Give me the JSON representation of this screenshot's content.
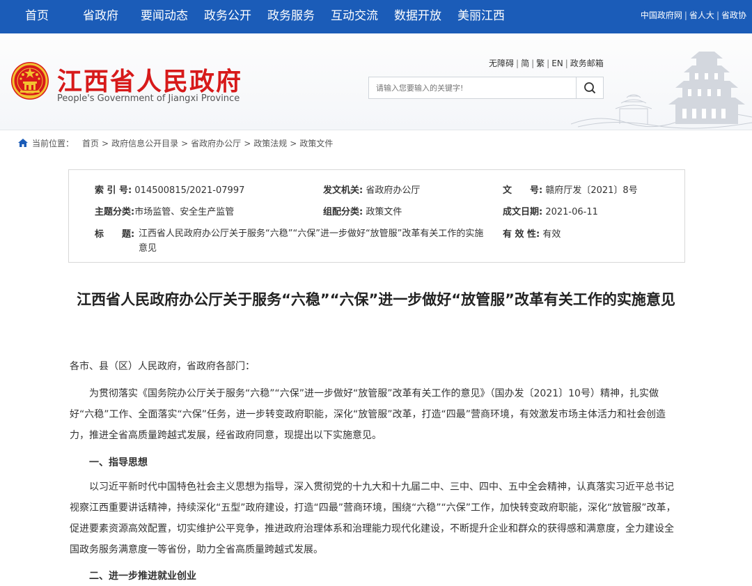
{
  "nav": {
    "items": [
      "首页",
      "省政府",
      "要闻动态",
      "政务公开",
      "政务服务",
      "互动交流",
      "数据开放",
      "美丽江西"
    ],
    "right_links": [
      "中国政府网",
      "省人大",
      "省政协"
    ]
  },
  "header": {
    "site_name": "江西省人民政府",
    "site_name_en": "People's Government of Jiangxi Province",
    "util_links": [
      "无障碍",
      "简",
      "繁",
      "EN",
      "政务邮箱"
    ],
    "search_placeholder": "请输入您要输入的关键字!"
  },
  "breadcrumb": {
    "label": "当前位置：",
    "items": [
      "首页",
      "政府信息公开目录",
      "省政府办公厅",
      "政策法规",
      "政策文件"
    ]
  },
  "info": {
    "index_label": "索 引 号:",
    "index_value": "014500815/2021-07997",
    "issuer_label": "发文机关:",
    "issuer_value": "省政府办公厅",
    "docno_label": "文　　号:",
    "docno_value": "赣府厅发〔2021〕8号",
    "topic_label": "主题分类:",
    "topic_value": "市场监管、安全生产监管",
    "category_label": "组配分类:",
    "category_value": "政策文件",
    "date_label": "成文日期:",
    "date_value": "2021-06-11",
    "title_label": "标　　题:",
    "title_value": "江西省人民政府办公厅关于服务“六稳”“六保”进一步做好“放管服”改革有关工作的实施意见",
    "valid_label": "有 效 性:",
    "valid_value": "有效"
  },
  "article": {
    "title": "江西省人民政府办公厅关于服务“六稳”“六保”进一步做好“放管服”改革有关工作的实施意见",
    "salutation": "各市、县（区）人民政府，省政府各部门：",
    "p1": "为贯彻落实《国务院办公厅关于服务“六稳”“六保”进一步做好“放管服”改革有关工作的意见》（国办发〔2021〕10号）精神，扎实做好“六稳”工作、全面落实“六保”任务，进一步转变政府职能，深化“放管服”改革，打造“四最”营商环境，有效激发市场主体活力和社会创造力，推进全省高质量跨越式发展，经省政府同意，现提出以下实施意见。",
    "h1": "一、指导思想",
    "p2": "以习近平新时代中国特色社会主义思想为指导，深入贯彻党的十九大和十九届二中、三中、四中、五中全会精神，认真落实习近平总书记视察江西重要讲话精神，持续深化“五型”政府建设，打造“四最”营商环境，围绕“六稳”“六保”工作，加快转变政府职能，深化“放管服”改革，促进要素资源高效配置，切实维护公平竞争，推进政府治理体系和治理能力现代化建设，不断提升企业和群众的获得感和满意度，全力建设全国政务服务满意度一等省份，助力全省高质量跨越式发展。",
    "h2": "二、进一步推进就业创业"
  },
  "colors": {
    "nav_bg": "#1b5cb8",
    "brand_red": "#d71a1a",
    "emblem_gold": "#f2c230"
  }
}
